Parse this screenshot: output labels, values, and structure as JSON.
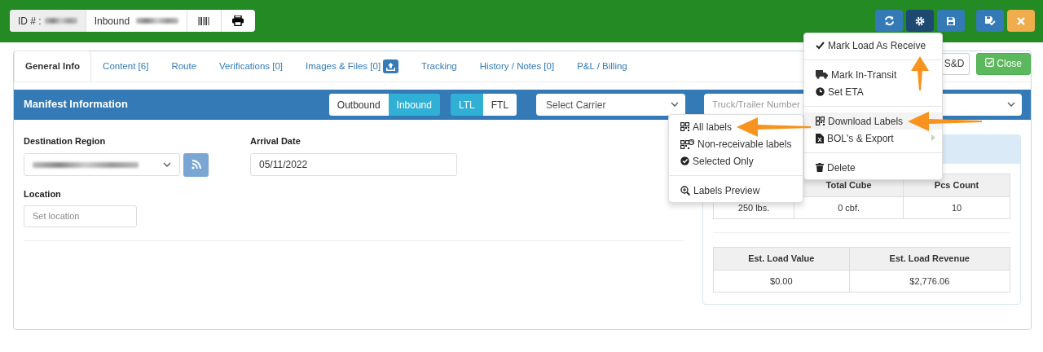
{
  "header": {
    "id_label": "ID # :",
    "direction_label": "Inbound"
  },
  "toolbar_buttons": [
    {
      "kind": "refresh",
      "selected": false
    },
    {
      "kind": "settings",
      "selected": true,
      "pointer_arrow": true
    },
    {
      "kind": "save",
      "selected": false
    },
    {
      "kind": "save-check",
      "selected": false
    },
    {
      "kind": "close",
      "selected": false
    }
  ],
  "tabs": [
    {
      "label": "General Info",
      "selected": true
    },
    {
      "label": "Content [6]",
      "selected": false
    },
    {
      "label": "Route",
      "selected": false
    },
    {
      "label": "Verifications [0]",
      "selected": false
    },
    {
      "label": "Images & Files [0]",
      "selected": false,
      "upload": true
    },
    {
      "label": "Tracking",
      "selected": false
    },
    {
      "label": "History / Notes [0]",
      "selected": false
    },
    {
      "label": "P&L / Billing",
      "selected": false
    }
  ],
  "tab_actions": [
    {
      "label": "S&D",
      "kind": "outline"
    },
    {
      "label": "Close",
      "kind": "success"
    }
  ],
  "panel": {
    "title": "Manifest Information",
    "direction_toggle": [
      {
        "label": "Outbound",
        "selected": false
      },
      {
        "label": "Inbound",
        "selected": true
      }
    ],
    "type_toggle": [
      {
        "label": "LTL",
        "selected": true
      },
      {
        "label": "FTL",
        "selected": false
      }
    ],
    "carrier_select": "Select Carrier",
    "truck_placeholder": "Truck/Trailer Number"
  },
  "form": {
    "destination_label": "Destination Region",
    "arrival_label": "Arrival Date",
    "arrival_value": "05/11/2022",
    "location_label": "Location",
    "location_placeholder": "Set location"
  },
  "summary": {
    "table_1": {
      "columns": [
        "Total Cube",
        "Pcs Count"
      ],
      "row": [
        "250 lbs.",
        "0 cbf.",
        "10"
      ]
    },
    "table_2": {
      "columns": [
        "Est. Load Value",
        "Est. Load Revenue"
      ],
      "row": [
        "$0.00",
        "$2,776.06"
      ]
    }
  },
  "actions_menu": [
    [
      {
        "label": "Mark Load As Receive",
        "kind": "check",
        "selected": false,
        "highlighted": false
      }
    ],
    [
      {
        "label": "Mark In-Transit",
        "kind": "truck",
        "selected": false,
        "highlighted": false
      },
      {
        "label": "Set ETA",
        "kind": "clock",
        "selected": false,
        "highlighted": false
      }
    ],
    [
      {
        "label": "Download Labels",
        "kind": "qr",
        "selected": true,
        "highlighted": true
      },
      {
        "label": "BOL's & Export",
        "kind": "file",
        "selected": false,
        "highlighted": false,
        "submenu": true
      }
    ],
    [
      {
        "label": "Delete",
        "kind": "trash",
        "selected": false,
        "highlighted": false
      }
    ]
  ],
  "labels_menu": [
    [
      {
        "label": "All labels",
        "kind": "qr",
        "highlighted": true
      },
      {
        "label": "Non-receivable labels",
        "kind": "qr-question",
        "highlighted": false
      },
      {
        "label": "Selected Only",
        "kind": "check-circle",
        "highlighted": false
      }
    ],
    [
      {
        "label": "Labels Preview",
        "kind": "zoom",
        "highlighted": false
      }
    ]
  ]
}
